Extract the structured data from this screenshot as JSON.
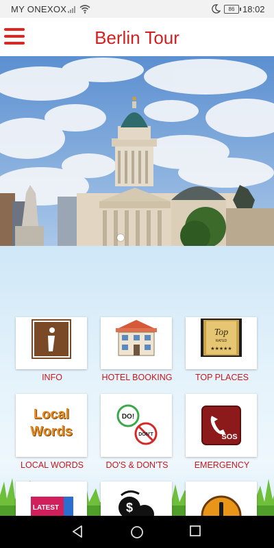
{
  "status_bar": {
    "carrier": "MY ONEXOX",
    "battery": "86",
    "time": "18:02"
  },
  "app_bar": {
    "title": "Berlin Tour",
    "menu_icon": "hamburger-menu-icon",
    "accent": "#e4231f"
  },
  "hero": {
    "slide_count": 1,
    "active_slide": 1
  },
  "tiles": [
    {
      "label": "INFO",
      "icon": "info-sign-icon"
    },
    {
      "label": "HOTEL BOOKING",
      "icon": "hotel-building-icon"
    },
    {
      "label": "TOP PLACES",
      "icon": "top-rated-badge-icon"
    },
    {
      "label": "LOCAL WORDS",
      "icon": "local-words-icon",
      "icon_text_1": "Local",
      "icon_text_2": "Words"
    },
    {
      "label": "DO'S & DON'TS",
      "icon": "dos-donts-icon",
      "icon_text_1": "DO!",
      "icon_text_2": "DON'T"
    },
    {
      "label": "EMERGENCY",
      "icon": "sos-phone-icon",
      "icon_text_1": "SOS"
    },
    {
      "label": "",
      "icon": "latest-news-icon",
      "icon_text_1": "LATEST"
    },
    {
      "label": "",
      "icon": "currency-exchange-icon"
    },
    {
      "label": "",
      "icon": "warning-icon"
    }
  ],
  "nav_bar": {
    "back": "back-icon",
    "home": "home-icon",
    "recents": "recents-icon"
  }
}
